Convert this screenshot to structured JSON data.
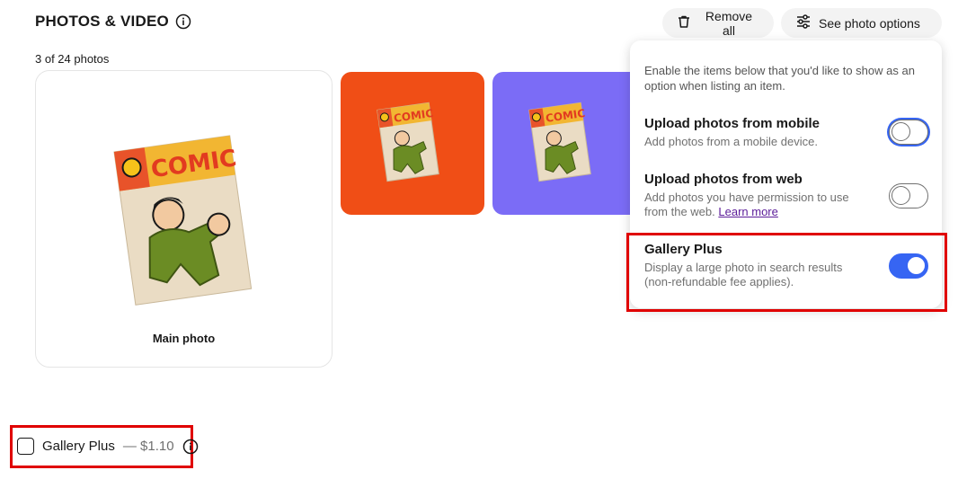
{
  "section": {
    "title": "PHOTOS & VIDEO",
    "photo_count": "3 of 24 photos",
    "info_icon": "info-icon"
  },
  "toolbar": {
    "remove_all": "Remove all",
    "remove_icon": "trash-icon",
    "see_options": "See photo options",
    "options_icon": "sliders-icon"
  },
  "photos": {
    "main_caption": "Main photo",
    "art_text": "COMIC",
    "thumb_colors": [
      "#f04e16",
      "#7b6cf6"
    ]
  },
  "popover": {
    "intro": "Enable the items below that you'd like to show as an option when listing an item.",
    "options": [
      {
        "title": "Upload photos from mobile",
        "desc": "Add photos from a mobile device.",
        "enabled": false
      },
      {
        "title": "Upload photos from web",
        "desc": "Add photos you have permission to use from the web.",
        "link": "Learn more",
        "enabled": false
      },
      {
        "title": "Gallery Plus",
        "desc": "Display a large photo in search results (non-refundable fee applies).",
        "enabled": true
      }
    ]
  },
  "gallery_plus": {
    "label": "Gallery Plus",
    "price": "— $1.10",
    "checked": false
  },
  "colors": {
    "accent": "#3665f3",
    "highlight": "#e00000",
    "link": "#5b1c99"
  }
}
